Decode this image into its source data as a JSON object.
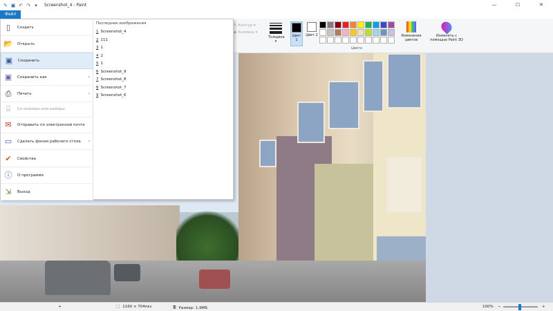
{
  "window": {
    "title": "Screenshot_4 - Paint",
    "minimize_glyph": "—",
    "maximize_glyph": "☐",
    "close_glyph": "✕"
  },
  "quick_access": [
    "paint-app-icon",
    "save-icon",
    "undo-icon",
    "redo-icon",
    "customize-arrow-icon"
  ],
  "file_tab": "Файл",
  "ribbon": {
    "outline_label": "Контур",
    "fill_label": "Заливка",
    "thickness_label": "Толщина",
    "color1_label": "Цвет 1",
    "color2_label": "Цвет 2",
    "colors_group_label": "Цвета",
    "edit_colors_label": "Изменение цветов",
    "paint3d_label": "Изменить с помощью Paint 3D",
    "color1_value": "#000000",
    "color2_value": "#ffffff",
    "palette": [
      "#000000",
      "#7f7f7f",
      "#880015",
      "#ed1c24",
      "#ff7f27",
      "#fff200",
      "#22b14c",
      "#00a2e8",
      "#3f48cc",
      "#a349a4",
      "#ffffff",
      "#c3c3c3",
      "#b97a57",
      "#ffaec9",
      "#ffc90e",
      "#efe4b0",
      "#b5e61d",
      "#99d9ea",
      "#7092be",
      "#c8bfe7",
      "#ffffff",
      "#ffffff",
      "#ffffff",
      "#ffffff",
      "#ffffff",
      "#ffffff",
      "#ffffff",
      "#ffffff",
      "#ffffff",
      "#ffffff"
    ]
  },
  "file_menu": {
    "items": [
      {
        "label": "Создать",
        "icon": "new-file-icon",
        "has_submenu": false
      },
      {
        "label": "Открыть",
        "icon": "open-folder-icon",
        "has_submenu": false
      },
      {
        "label": "Сохранить",
        "icon": "save-icon",
        "has_submenu": false
      },
      {
        "label": "Сохранить как",
        "icon": "save-as-icon",
        "has_submenu": true
      },
      {
        "label": "Печать",
        "icon": "printer-icon",
        "has_submenu": true
      },
      {
        "label": "Со сканера или камеры",
        "icon": "scanner-icon",
        "has_submenu": false
      },
      {
        "label": "Отправить по электронной почте",
        "icon": "email-icon",
        "has_submenu": false
      },
      {
        "label": "Сделать фоном рабочего стола",
        "icon": "desktop-background-icon",
        "has_submenu": true
      },
      {
        "label": "Свойства",
        "icon": "properties-checkmark-icon",
        "has_submenu": false
      },
      {
        "label": "О программе",
        "icon": "info-icon",
        "has_submenu": false
      },
      {
        "label": "Выход",
        "icon": "exit-icon",
        "has_submenu": false
      }
    ],
    "selected_index": 2,
    "recent_title": "Последние изображения",
    "recent": [
      {
        "num": "1",
        "name": "Screenshot_4"
      },
      {
        "num": "2",
        "name": "111"
      },
      {
        "num": "3",
        "name": "1"
      },
      {
        "num": "4",
        "name": "2"
      },
      {
        "num": "5",
        "name": "1"
      },
      {
        "num": "6",
        "name": "Screenshot_9"
      },
      {
        "num": "7",
        "name": "Screenshot_8"
      },
      {
        "num": "8",
        "name": "Screenshot_7"
      },
      {
        "num": "9",
        "name": "Screenshot_6"
      }
    ]
  },
  "statusbar": {
    "dimensions": "1160 × 704пкс",
    "size": "Размер: 1,9МБ",
    "zoom": "100%",
    "zoom_minus": "−",
    "zoom_plus": "+"
  }
}
